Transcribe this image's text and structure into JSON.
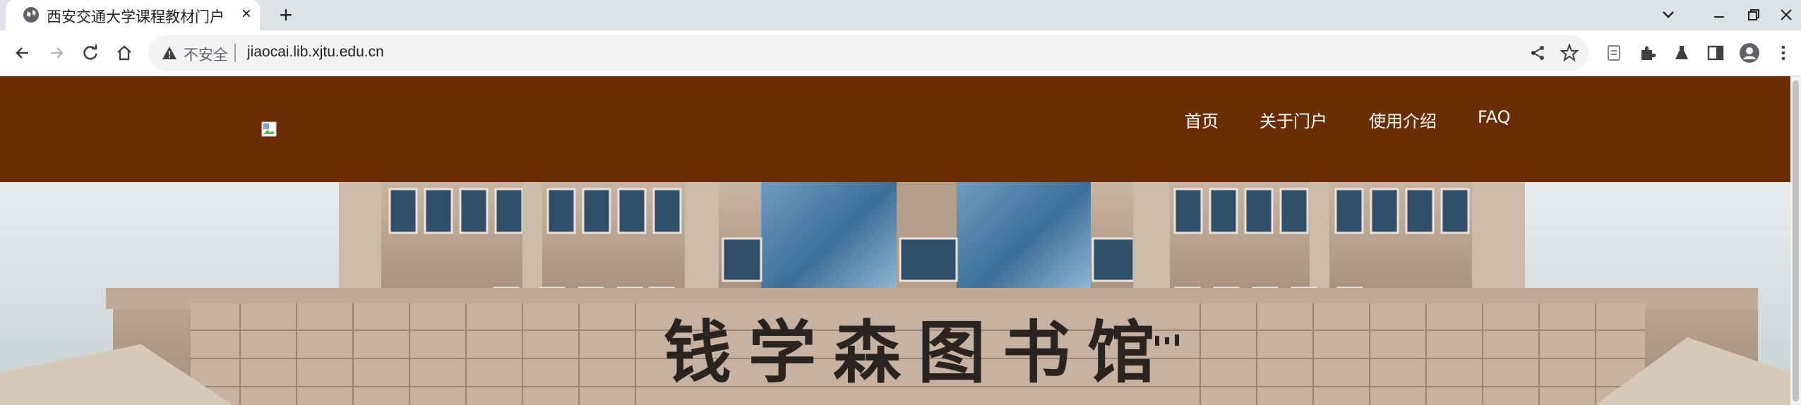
{
  "browser": {
    "tab_title": "西安交通大学课程教材门户",
    "tab_close": "×",
    "new_tab": "+",
    "security_label": "不安全",
    "url": "jiaocai.lib.xjtu.edu.cn"
  },
  "site": {
    "nav": [
      "首页",
      "关于门户",
      "使用介绍",
      "FAQ"
    ],
    "hero_inscription": "钱学森图书馆",
    "header_color": "#6b2d02"
  }
}
